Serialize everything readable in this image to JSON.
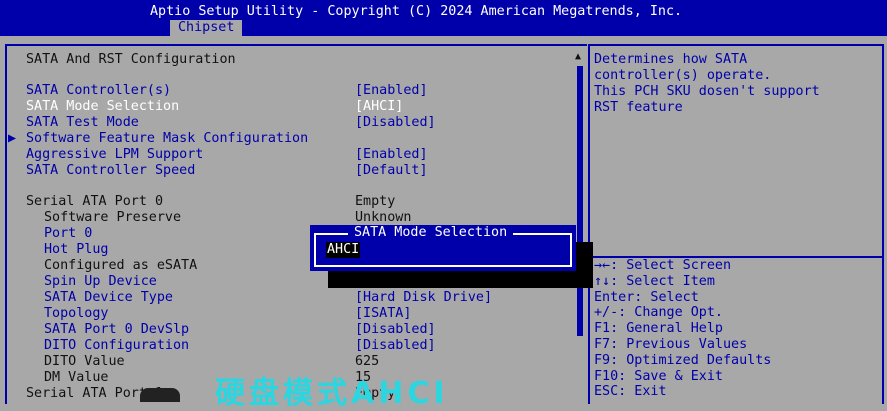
{
  "header": {
    "title": "Aptio Setup Utility - Copyright (C) 2024 American Megatrends, Inc.",
    "active_tab": "Chipset"
  },
  "page_title": "SATA And RST Configuration",
  "settings": [
    {
      "label": "SATA Controller(s)",
      "value": "[Enabled]",
      "indent": 0,
      "selectable": true
    },
    {
      "label": "SATA Mode Selection",
      "value": "[AHCI]",
      "indent": 0,
      "selectable": true,
      "highlighted": true
    },
    {
      "label": "SATA Test Mode",
      "value": "[Disabled]",
      "indent": 0,
      "selectable": true
    },
    {
      "label": "Software Feature Mask Configuration",
      "value": "",
      "indent": 0,
      "selectable": true,
      "submenu": true
    },
    {
      "label": "Aggressive LPM Support",
      "value": "[Enabled]",
      "indent": 0,
      "selectable": true
    },
    {
      "label": "SATA Controller Speed",
      "value": "[Default]",
      "indent": 0,
      "selectable": true
    },
    {
      "label": "Serial ATA Port 0",
      "value": "Empty",
      "indent": 0,
      "selectable": false
    },
    {
      "label": "Software Preserve",
      "value": "Unknown",
      "indent": 1,
      "selectable": false
    },
    {
      "label": "Port 0",
      "value": "",
      "indent": 1,
      "selectable": true
    },
    {
      "label": "Hot Plug",
      "value": "",
      "indent": 1,
      "selectable": true
    },
    {
      "label": "Configured as eSATA",
      "value": "",
      "indent": 1,
      "selectable": false
    },
    {
      "label": "Spin Up Device",
      "value": "",
      "indent": 1,
      "selectable": true
    },
    {
      "label": "SATA Device Type",
      "value": "[Hard Disk Drive]",
      "indent": 1,
      "selectable": true
    },
    {
      "label": "Topology",
      "value": "[ISATA]",
      "indent": 1,
      "selectable": true
    },
    {
      "label": "SATA Port 0 DevSlp",
      "value": "[Disabled]",
      "indent": 1,
      "selectable": true
    },
    {
      "label": "DITO Configuration",
      "value": "[Disabled]",
      "indent": 1,
      "selectable": true
    },
    {
      "label": "DITO Value",
      "value": "625",
      "indent": 1,
      "selectable": false
    },
    {
      "label": "DM Value",
      "value": "15",
      "indent": 1,
      "selectable": false
    },
    {
      "label": "Serial ATA Port 1",
      "value": "Empty",
      "indent": 0,
      "selectable": false
    }
  ],
  "help_text": [
    "Determines how SATA",
    "controller(s) operate.",
    "This PCH SKU dosen't support",
    "RST feature"
  ],
  "key_help": [
    "→←: Select Screen",
    "↑↓: Select Item",
    "Enter: Select",
    "+/-: Change Opt.",
    "F1: General Help",
    "F7: Previous Values",
    "F9: Optimized Defaults",
    "F10: Save & Exit",
    "ESC: Exit"
  ],
  "popup": {
    "title": "SATA Mode Selection",
    "options": [
      "AHCI"
    ]
  },
  "overlay_text": "硬盘模式AHCI",
  "colors": {
    "background": "#a8a8a8",
    "accent": "#0000aa",
    "text": "#111111",
    "highlight_text": "#ffffff",
    "overlay": "#2ad6e0"
  },
  "icons": {
    "submenu": "triangle-right-icon",
    "scroll_up": "triangle-up-icon"
  }
}
